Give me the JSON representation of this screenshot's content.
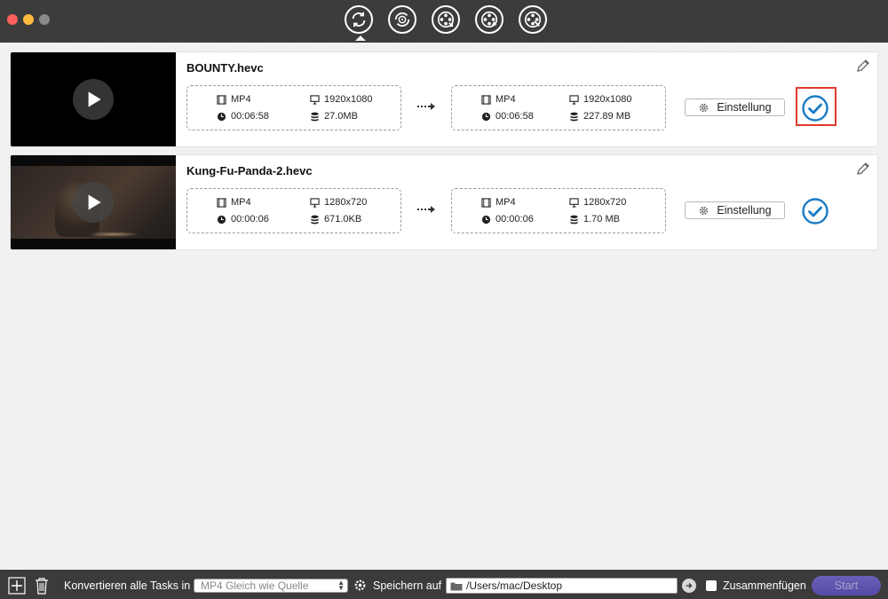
{
  "toolbar": {
    "buttons": [
      {
        "name": "convert-tab",
        "icon": "convert-arrows-icon",
        "active": true
      },
      {
        "name": "rotate-tab",
        "icon": "rotate-film-icon",
        "active": false
      },
      {
        "name": "download-tab",
        "icon": "film-reel-down-icon",
        "active": false
      },
      {
        "name": "burn-tab",
        "icon": "film-reel-burn-icon",
        "active": false
      },
      {
        "name": "tools-tab",
        "icon": "film-reel-tools-icon",
        "active": false
      }
    ]
  },
  "tasks": [
    {
      "filename": "BOUNTY.hevc",
      "source": {
        "format": "MP4",
        "resolution": "1920x1080",
        "duration": "00:06:58",
        "size": "27.0MB"
      },
      "output": {
        "format": "MP4",
        "resolution": "1920x1080",
        "duration": "00:06:58",
        "size": "227.89 MB"
      },
      "settings_label": "Einstellung",
      "status": "done",
      "highlighted": true
    },
    {
      "filename": "Kung-Fu-Panda-2.hevc",
      "source": {
        "format": "MP4",
        "resolution": "1280x720",
        "duration": "00:00:06",
        "size": "671.0KB"
      },
      "output": {
        "format": "MP4",
        "resolution": "1280x720",
        "duration": "00:00:06",
        "size": "1.70 MB"
      },
      "settings_label": "Einstellung",
      "status": "done",
      "highlighted": false
    }
  ],
  "bottom": {
    "convert_all_label": "Konvertieren alle Tasks in",
    "format_value": "MP4 Gleich wie Quelle",
    "save_label": "Speichern auf",
    "path_value": "/Users/mac/Desktop",
    "merge_label": "Zusammenfügen",
    "merge_checked": false,
    "start_label": "Start"
  },
  "colors": {
    "accent_blue": "#1a7bc4",
    "highlight_red": "#e03a2e",
    "titlebar": "#3c3c3c",
    "start_button": "#5b50ab"
  }
}
